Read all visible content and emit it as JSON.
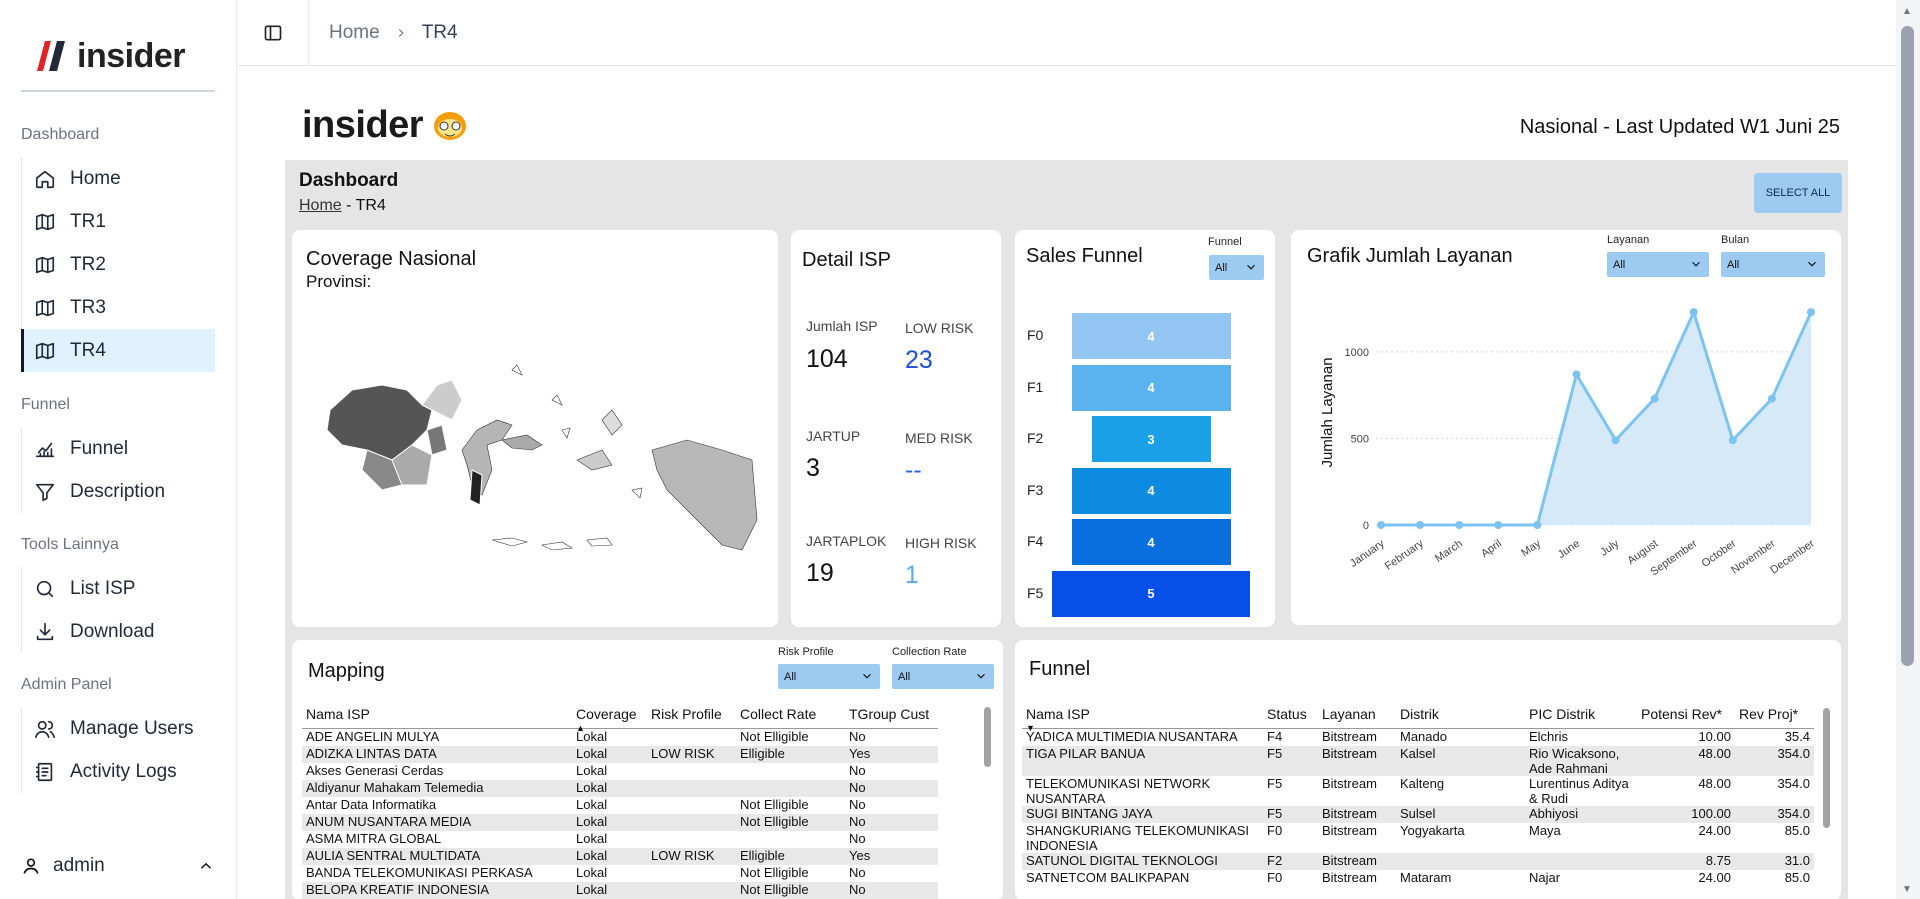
{
  "brand": {
    "name": "insider"
  },
  "sidebar": {
    "sections": [
      {
        "title": "Dashboard",
        "items": [
          {
            "label": "Home",
            "icon": "home-icon"
          },
          {
            "label": "TR1",
            "icon": "map-icon"
          },
          {
            "label": "TR2",
            "icon": "map-icon"
          },
          {
            "label": "TR3",
            "icon": "map-icon"
          },
          {
            "label": "TR4",
            "icon": "map-icon",
            "active": true
          }
        ]
      },
      {
        "title": "Funnel",
        "items": [
          {
            "label": "Funnel",
            "icon": "chart-icon"
          },
          {
            "label": "Description",
            "icon": "filter-icon"
          }
        ]
      },
      {
        "title": "Tools Lainnya",
        "items": [
          {
            "label": "List ISP",
            "icon": "search-icon"
          },
          {
            "label": "Download",
            "icon": "download-icon"
          }
        ]
      },
      {
        "title": "Admin Panel",
        "items": [
          {
            "label": "Manage Users",
            "icon": "users-icon"
          },
          {
            "label": "Activity Logs",
            "icon": "logs-icon"
          }
        ]
      }
    ],
    "user": "admin"
  },
  "topbar": {
    "breadcrumb": [
      "Home",
      "TR4"
    ]
  },
  "report": {
    "status": "Nasional - Last Updated W1 Juni 25",
    "title": "Dashboard",
    "crumb_link": "Home",
    "crumb_rest": "- TR4",
    "select_all": "SELECT ALL",
    "coverage": {
      "title": "Coverage Nasional",
      "subtitle": "Provinsi:"
    },
    "detail": {
      "title": "Detail ISP",
      "stats": [
        {
          "label": "Jumlah ISP",
          "value": "104",
          "color": "#111111"
        },
        {
          "label": "LOW RISK",
          "value": "23",
          "color": "#1d4ed8"
        },
        {
          "label": "JARTUP",
          "value": "3",
          "color": "#111111"
        },
        {
          "label": "MED RISK",
          "value": "--",
          "color": "#2563eb"
        },
        {
          "label": "JARTAPLOK",
          "value": "19",
          "color": "#111111"
        },
        {
          "label": "HIGH RISK",
          "value": "1",
          "color": "#60a5fa"
        }
      ]
    },
    "sales_funnel": {
      "title": "Sales Funnel",
      "filter_label": "Funnel",
      "filter_value": "All",
      "stages": [
        {
          "label": "F0",
          "value": 4,
          "color": "#93c5f3"
        },
        {
          "label": "F1",
          "value": 4,
          "color": "#5ab3ef"
        },
        {
          "label": "F2",
          "value": 3,
          "color": "#1aa0e8"
        },
        {
          "label": "F3",
          "value": 4,
          "color": "#0d8be0"
        },
        {
          "label": "F4",
          "value": 4,
          "color": "#0a6fde"
        },
        {
          "label": "F5",
          "value": 5,
          "color": "#0650e8"
        }
      ]
    },
    "mapping": {
      "title": "Mapping",
      "filters": [
        {
          "label": "Risk Profile",
          "value": "All"
        },
        {
          "label": "Collection Rate",
          "value": "All"
        }
      ],
      "columns": [
        "Nama ISP",
        "Coverage",
        "Risk Profile",
        "Collect Rate",
        "TGroup Cust"
      ],
      "rows": [
        [
          "ADE ANGELIN MULYA",
          "Lokal",
          "",
          "Not Elligible",
          "No"
        ],
        [
          "ADIZKA LINTAS DATA",
          "Lokal",
          "LOW RISK",
          "Elligible",
          "Yes"
        ],
        [
          "Akses Generasi Cerdas",
          "Lokal",
          "",
          "",
          "No"
        ],
        [
          "Aldiyanur Mahakam Telemedia",
          "Lokal",
          "",
          "",
          "No"
        ],
        [
          "Antar Data Informatika",
          "Lokal",
          "",
          "Not Elligible",
          "No"
        ],
        [
          "ANUM NUSANTARA MEDIA",
          "Lokal",
          "",
          "Not Elligible",
          "No"
        ],
        [
          "ASMA MITRA GLOBAL",
          "Lokal",
          "",
          "",
          "No"
        ],
        [
          "AULIA SENTRAL MULTIDATA",
          "Lokal",
          "LOW RISK",
          "Elligible",
          "Yes"
        ],
        [
          "BANDA TELEKOMUNIKASI PERKASA",
          "Lokal",
          "",
          "Not Elligible",
          "No"
        ],
        [
          "BELOPA KREATIF INDONESIA",
          "Lokal",
          "",
          "Not Elligible",
          "No"
        ]
      ]
    },
    "funnel_table": {
      "title": "Funnel",
      "columns": [
        "Nama ISP",
        "Status",
        "Layanan",
        "Distrik",
        "PIC Distrik",
        "Potensi Rev*",
        "Rev Proj*"
      ],
      "rows": [
        [
          "YADICA MULTIMEDIA NUSANTARA",
          "F4",
          "Bitstream",
          "Manado",
          "Elchris",
          "10.00",
          "35.4"
        ],
        [
          "TIGA PILAR BANUA",
          "F5",
          "Bitstream",
          "Kalsel",
          "Rio Wicaksono, Ade Rahmani",
          "48.00",
          "354.0"
        ],
        [
          "TELEKOMUNIKASI NETWORK NUSANTARA",
          "F5",
          "Bitstream",
          "Kalteng",
          "Lurentinus Aditya & Rudi",
          "48.00",
          "354.0"
        ],
        [
          "SUGI BINTANG JAYA",
          "F5",
          "Bitstream",
          "Sulsel",
          "Abhiyosi",
          "100.00",
          "354.0"
        ],
        [
          "SHANGKURIANG TELEKOMUNIKASI INDONESIA",
          "F0",
          "Bitstream",
          "Yogyakarta",
          "Maya",
          "24.00",
          "85.0"
        ],
        [
          "SATUNOL DIGITAL TEKNOLOGI",
          "F2",
          "Bitstream",
          "",
          "",
          "8.75",
          "31.0"
        ],
        [
          "SATNETCOM BALIKPAPAN",
          "F0",
          "Bitstream",
          "Mataram",
          "Najar",
          "24.00",
          "85.0"
        ]
      ]
    }
  },
  "chart_data": {
    "type": "area",
    "title": "Grafik Jumlah Layanan",
    "filters": [
      {
        "label": "Layanan",
        "value": "All"
      },
      {
        "label": "Bulan",
        "value": "All"
      }
    ],
    "ylabel": "Jumlah Layanan",
    "xlabel": "",
    "categories": [
      "January",
      "February",
      "March",
      "April",
      "May",
      "June",
      "July",
      "August",
      "September",
      "October",
      "November",
      "December"
    ],
    "values": [
      0,
      0,
      0,
      0,
      0,
      870,
      490,
      730,
      1230,
      490,
      730,
      1230
    ],
    "yticks": [
      0,
      500,
      1000
    ],
    "ylim": [
      0,
      1300
    ],
    "grid": true,
    "color": "#7dc3f0"
  }
}
